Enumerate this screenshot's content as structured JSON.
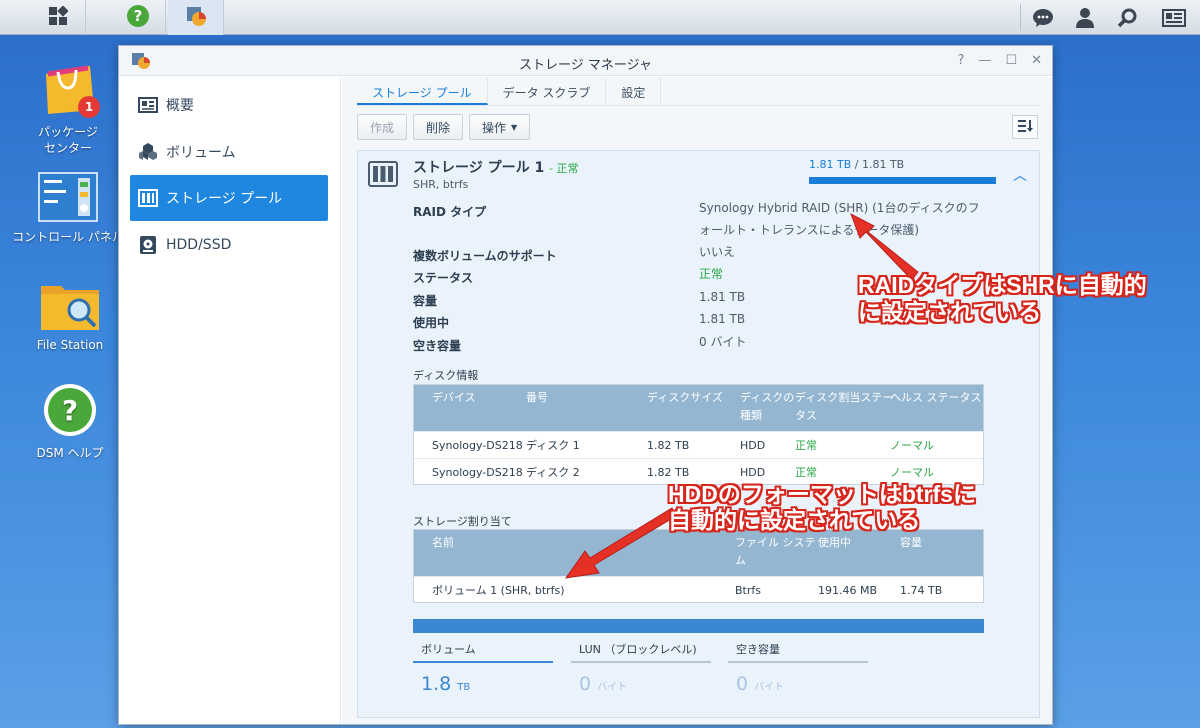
{
  "taskbar": {
    "main_menu_icon": "grid-icon",
    "apps": [
      "help-icon",
      "storage-manager-icon"
    ],
    "right_icons": [
      "chat-icon",
      "user-icon",
      "search-icon",
      "widget-icon"
    ]
  },
  "desktop": {
    "icons": [
      {
        "label": "パッケージ\nセンター",
        "badge": "1"
      },
      {
        "label": "コントロール パネル"
      },
      {
        "label": "File Station"
      },
      {
        "label": "DSM ヘルプ"
      }
    ]
  },
  "window": {
    "title": "ストレージ マネージャ",
    "controls": [
      "?",
      "—",
      "☐",
      "✕"
    ],
    "sidebar": [
      {
        "label": "概要",
        "icon": "overview-icon"
      },
      {
        "label": "ボリューム",
        "icon": "volume-icon"
      },
      {
        "label": "ストレージ プール",
        "icon": "storage-pool-icon"
      },
      {
        "label": "HDD/SSD",
        "icon": "hdd-icon"
      }
    ],
    "tabs": [
      "ストレージ プール",
      "データ スクラブ",
      "設定"
    ],
    "toolbar": {
      "create": "作成",
      "delete": "削除",
      "action": "操作"
    },
    "pool": {
      "name": "ストレージ プール 1",
      "status": "- 正常",
      "sub": "SHR, btrfs",
      "usage_used": "1.81 TB",
      "usage_rest": " / 1.81 TB",
      "usage_fraction": 1.0,
      "props": [
        {
          "label": "RAID タイプ",
          "value": "Synology Hybrid RAID (SHR) (1台のディスクのフォールト・トレランスによるデータ保護)"
        },
        {
          "label": "複数ボリュームのサポート",
          "value": "いいえ"
        },
        {
          "label": "ステータス",
          "value": "正常"
        },
        {
          "label": "容量",
          "value": "1.81 TB"
        },
        {
          "label": "使用中",
          "value": "1.81 TB"
        },
        {
          "label": "空き容量",
          "value": "0 バイト"
        }
      ],
      "disk_section": "ディスク情報",
      "disk_headers": [
        "デバイス",
        "番号",
        "ディスクサイズ",
        "ディスクの\n種類",
        "ディスク割当ステー\nタス",
        "ヘルス ステータス"
      ],
      "disks": [
        [
          "Synology-DS218",
          "ディスク 1",
          "1.82 TB",
          "HDD",
          "正常",
          "ノーマル"
        ],
        [
          "Synology-DS218",
          "ディスク 2",
          "1.82 TB",
          "HDD",
          "正常",
          "ノーマル"
        ]
      ],
      "alloc_section": "ストレージ割り当て",
      "alloc_headers": [
        "名前",
        "ファイル システ\nム",
        "使用中",
        "容量"
      ],
      "alloc": [
        [
          "ボリューム 1 (SHR, btrfs)",
          "Btrfs",
          "191.46 MB",
          "1.74 TB"
        ]
      ],
      "summary": [
        {
          "label": "ボリューム",
          "value": "1.8",
          "unit": "TB"
        },
        {
          "label": "LUN （ブロックレベル)",
          "value": "0",
          "unit": "バイト"
        },
        {
          "label": "空き容量",
          "value": "0",
          "unit": "バイト"
        }
      ]
    }
  },
  "annotations": {
    "raid_note_1": "RAIDタイプはSHRに自動的",
    "raid_note_2": "に設定されている",
    "hdd_note_1": "HDDのフォーマットはbtrfsに",
    "hdd_note_2": "自動的に設定されている",
    "color": "#d6261c"
  }
}
